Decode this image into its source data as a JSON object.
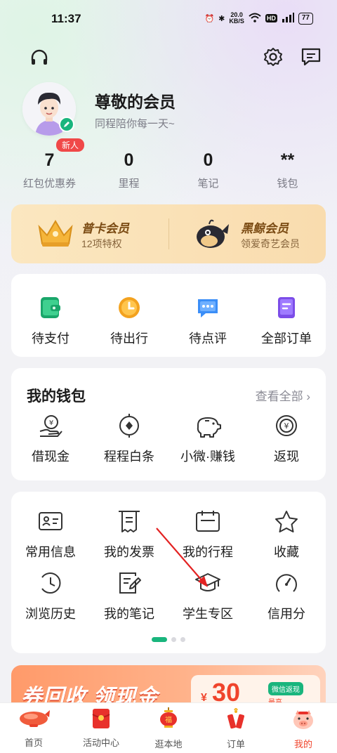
{
  "status_bar": {
    "time": "11:37",
    "net_speed": "20.0",
    "net_unit": "KB/S",
    "battery": "77",
    "hd": "HD",
    "signal": "5G"
  },
  "header": {
    "left_icon": "headset-icon",
    "right_icons": [
      "gear-icon",
      "message-icon"
    ]
  },
  "profile": {
    "name": "尊敬的会员",
    "slogan": "同程陪你每一天~",
    "badge": "新人"
  },
  "stats": [
    {
      "value": "7",
      "label": "红包优惠券"
    },
    {
      "value": "0",
      "label": "里程"
    },
    {
      "value": "0",
      "label": "笔记"
    },
    {
      "value": "**",
      "label": "钱包"
    }
  ],
  "membership": [
    {
      "title": "普卡会员",
      "subtitle": "12项特权",
      "icon": "crown-icon"
    },
    {
      "title": "黑鲸会员",
      "subtitle": "领爱奇艺会员",
      "icon": "whale-icon"
    }
  ],
  "orders": [
    {
      "label": "待支付",
      "icon": "wallet-icon"
    },
    {
      "label": "待出行",
      "icon": "clock-icon"
    },
    {
      "label": "待点评",
      "icon": "comment-icon"
    },
    {
      "label": "全部订单",
      "icon": "document-icon"
    }
  ],
  "wallet": {
    "title": "我的钱包",
    "more": "查看全部",
    "items": [
      {
        "label": "借现金",
        "icon": "yuan-hand-icon"
      },
      {
        "label": "程程白条",
        "icon": "coin-icon"
      },
      {
        "label": "小微·赚钱",
        "icon": "piggy-bank-icon"
      },
      {
        "label": "返现",
        "icon": "cashback-icon"
      }
    ]
  },
  "services": {
    "row1": [
      {
        "label": "常用信息",
        "icon": "id-card-icon"
      },
      {
        "label": "我的发票",
        "icon": "receipt-icon"
      },
      {
        "label": "我的行程",
        "icon": "calendar-icon"
      },
      {
        "label": "收藏",
        "icon": "star-icon"
      }
    ],
    "row2": [
      {
        "label": "浏览历史",
        "icon": "history-icon"
      },
      {
        "label": "我的笔记",
        "icon": "note-icon"
      },
      {
        "label": "学生专区",
        "icon": "graduation-cap-icon"
      },
      {
        "label": "信用分",
        "icon": "gauge-icon"
      }
    ]
  },
  "banner": {
    "title": "券回收 领现金",
    "amount": "30",
    "currency": "¥",
    "tag": "微信返现",
    "sub": "最高"
  },
  "tabbar": [
    {
      "label": "首页",
      "icon": "airship-icon"
    },
    {
      "label": "活动中心",
      "icon": "red-envelope-icon"
    },
    {
      "label": "逛本地",
      "icon": "lantern-icon"
    },
    {
      "label": "订单",
      "icon": "firecracker-icon"
    },
    {
      "label": "我的",
      "icon": "pig-icon",
      "active": true
    }
  ],
  "colors": {
    "accent": "#19b57d",
    "red": "#f0442c",
    "gold": "#f9dcae"
  }
}
